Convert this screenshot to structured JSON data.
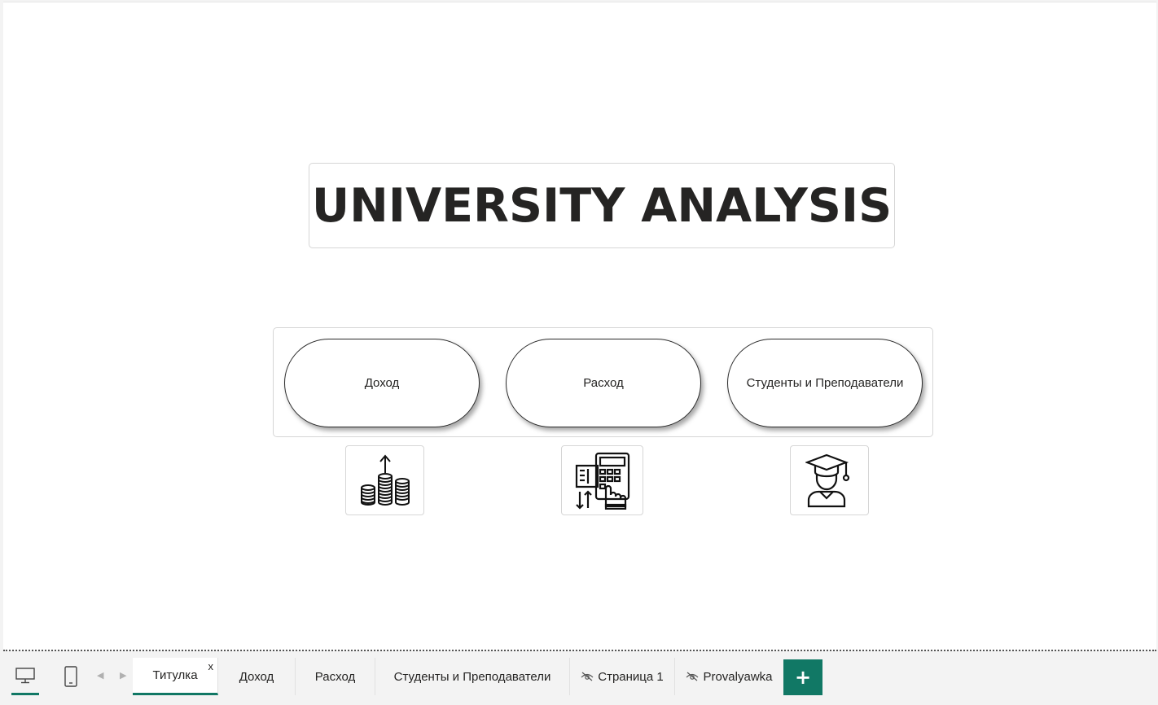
{
  "report": {
    "title": "UNIVERSITY ANALYSIS",
    "nav_buttons": [
      {
        "label": "Доход"
      },
      {
        "label": "Расход"
      },
      {
        "label": "Студенты и Преподаватели"
      }
    ],
    "icons": [
      "coins-growth-icon",
      "calculator-receipt-icon",
      "graduate-student-icon"
    ]
  },
  "page_tabs": [
    {
      "label": "Титулка",
      "active": true,
      "close_label": "x"
    },
    {
      "label": "Доход"
    },
    {
      "label": "Расход"
    },
    {
      "label": "Студенты и Преподаватели"
    },
    {
      "label": "Страница 1",
      "hidden": true
    },
    {
      "label": "Provalyawka",
      "hidden": true
    }
  ],
  "tabbar": {
    "add_page_label": "+",
    "view_modes": [
      "desktop-view-icon",
      "mobile-view-icon"
    ]
  },
  "colors": {
    "accent": "#117865",
    "title_text": "#252423",
    "border": "#d6d6d6"
  }
}
